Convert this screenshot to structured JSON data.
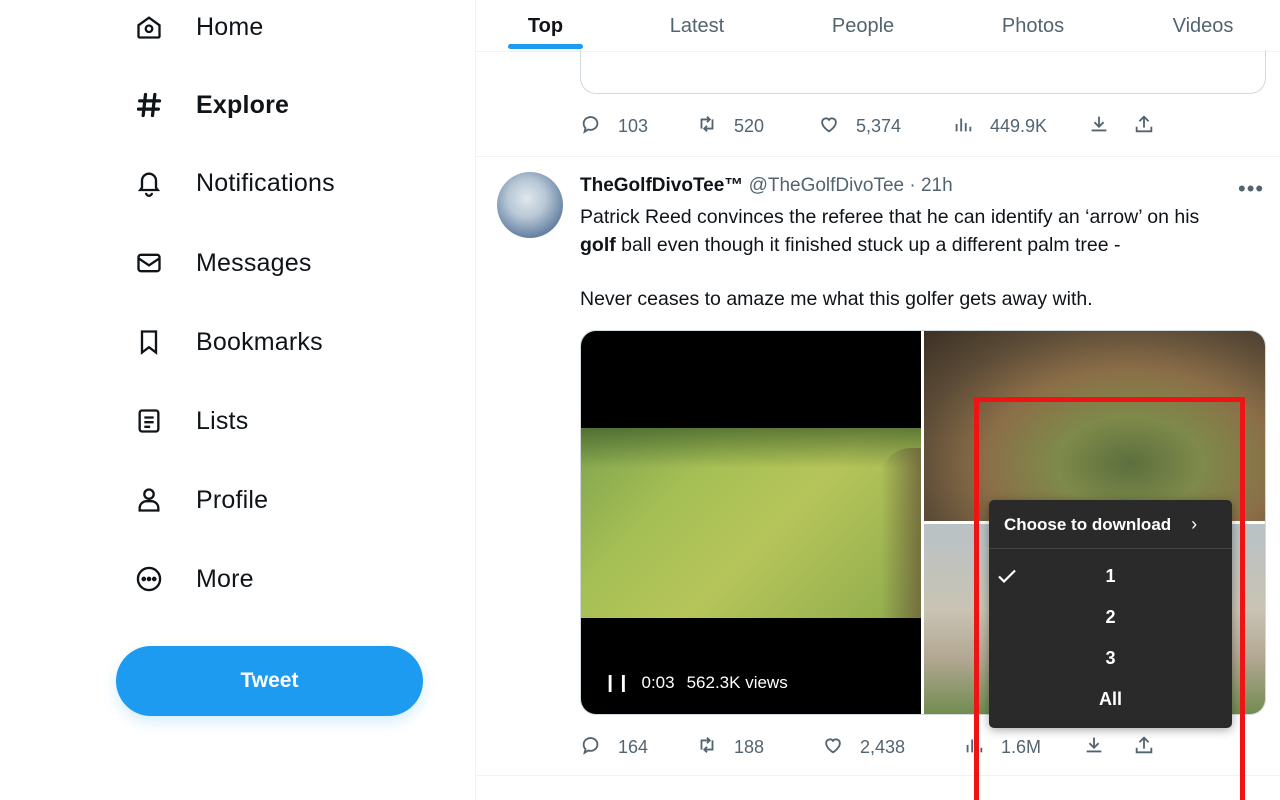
{
  "sidebar": {
    "items": [
      {
        "label": "Home",
        "icon": "home-icon"
      },
      {
        "label": "Explore",
        "icon": "hashtag-icon"
      },
      {
        "label": "Notifications",
        "icon": "bell-icon"
      },
      {
        "label": "Messages",
        "icon": "envelope-icon"
      },
      {
        "label": "Bookmarks",
        "icon": "bookmark-icon"
      },
      {
        "label": "Lists",
        "icon": "list-icon"
      },
      {
        "label": "Profile",
        "icon": "person-icon"
      },
      {
        "label": "More",
        "icon": "more-circle-icon"
      }
    ],
    "active": "Explore",
    "tweet_button": "Tweet"
  },
  "tabs": [
    "Top",
    "Latest",
    "People",
    "Photos",
    "Videos"
  ],
  "active_tab": "Top",
  "previous_tweet": {
    "replies": "103",
    "retweets": "520",
    "likes": "5,374",
    "views": "449.9K"
  },
  "tweet": {
    "name": "TheGolfDivoTee™",
    "handle": "@TheGolfDivoTee",
    "separator": "·",
    "time": "21h",
    "text_line1": "Patrick Reed convinces the referee that he can identify an ‘arrow’ on his",
    "text_bold": "golf",
    "text_line2_rest": " ball even though it finished stuck up a different palm tree -",
    "text_line3": "Never ceases to amaze me what this golfer gets away with.",
    "video_time": "0:03",
    "video_views": "562.3K views",
    "replies": "164",
    "retweets": "188",
    "likes": "2,438",
    "views": "1.6M"
  },
  "download_menu": {
    "title": "Choose to download",
    "options": [
      "1",
      "2",
      "3",
      "All"
    ],
    "selected": "1"
  },
  "colors": {
    "accent": "#1d9bf0",
    "highlight": "#ef1414",
    "popover_bg": "#2a2a2a"
  }
}
